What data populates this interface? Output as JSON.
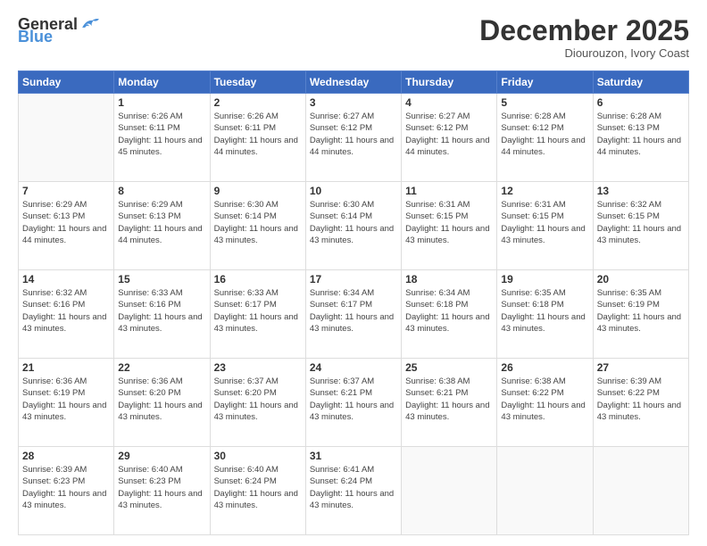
{
  "header": {
    "logo_general": "General",
    "logo_blue": "Blue",
    "month": "December 2025",
    "location": "Diourouzon, Ivory Coast"
  },
  "calendar": {
    "days_of_week": [
      "Sunday",
      "Monday",
      "Tuesday",
      "Wednesday",
      "Thursday",
      "Friday",
      "Saturday"
    ],
    "weeks": [
      [
        {
          "day": "",
          "info": ""
        },
        {
          "day": "1",
          "info": "Sunrise: 6:26 AM\nSunset: 6:11 PM\nDaylight: 11 hours and 45 minutes."
        },
        {
          "day": "2",
          "info": "Sunrise: 6:26 AM\nSunset: 6:11 PM\nDaylight: 11 hours and 44 minutes."
        },
        {
          "day": "3",
          "info": "Sunrise: 6:27 AM\nSunset: 6:12 PM\nDaylight: 11 hours and 44 minutes."
        },
        {
          "day": "4",
          "info": "Sunrise: 6:27 AM\nSunset: 6:12 PM\nDaylight: 11 hours and 44 minutes."
        },
        {
          "day": "5",
          "info": "Sunrise: 6:28 AM\nSunset: 6:12 PM\nDaylight: 11 hours and 44 minutes."
        },
        {
          "day": "6",
          "info": "Sunrise: 6:28 AM\nSunset: 6:13 PM\nDaylight: 11 hours and 44 minutes."
        }
      ],
      [
        {
          "day": "7",
          "info": "Sunrise: 6:29 AM\nSunset: 6:13 PM\nDaylight: 11 hours and 44 minutes."
        },
        {
          "day": "8",
          "info": "Sunrise: 6:29 AM\nSunset: 6:13 PM\nDaylight: 11 hours and 44 minutes."
        },
        {
          "day": "9",
          "info": "Sunrise: 6:30 AM\nSunset: 6:14 PM\nDaylight: 11 hours and 43 minutes."
        },
        {
          "day": "10",
          "info": "Sunrise: 6:30 AM\nSunset: 6:14 PM\nDaylight: 11 hours and 43 minutes."
        },
        {
          "day": "11",
          "info": "Sunrise: 6:31 AM\nSunset: 6:15 PM\nDaylight: 11 hours and 43 minutes."
        },
        {
          "day": "12",
          "info": "Sunrise: 6:31 AM\nSunset: 6:15 PM\nDaylight: 11 hours and 43 minutes."
        },
        {
          "day": "13",
          "info": "Sunrise: 6:32 AM\nSunset: 6:15 PM\nDaylight: 11 hours and 43 minutes."
        }
      ],
      [
        {
          "day": "14",
          "info": "Sunrise: 6:32 AM\nSunset: 6:16 PM\nDaylight: 11 hours and 43 minutes."
        },
        {
          "day": "15",
          "info": "Sunrise: 6:33 AM\nSunset: 6:16 PM\nDaylight: 11 hours and 43 minutes."
        },
        {
          "day": "16",
          "info": "Sunrise: 6:33 AM\nSunset: 6:17 PM\nDaylight: 11 hours and 43 minutes."
        },
        {
          "day": "17",
          "info": "Sunrise: 6:34 AM\nSunset: 6:17 PM\nDaylight: 11 hours and 43 minutes."
        },
        {
          "day": "18",
          "info": "Sunrise: 6:34 AM\nSunset: 6:18 PM\nDaylight: 11 hours and 43 minutes."
        },
        {
          "day": "19",
          "info": "Sunrise: 6:35 AM\nSunset: 6:18 PM\nDaylight: 11 hours and 43 minutes."
        },
        {
          "day": "20",
          "info": "Sunrise: 6:35 AM\nSunset: 6:19 PM\nDaylight: 11 hours and 43 minutes."
        }
      ],
      [
        {
          "day": "21",
          "info": "Sunrise: 6:36 AM\nSunset: 6:19 PM\nDaylight: 11 hours and 43 minutes."
        },
        {
          "day": "22",
          "info": "Sunrise: 6:36 AM\nSunset: 6:20 PM\nDaylight: 11 hours and 43 minutes."
        },
        {
          "day": "23",
          "info": "Sunrise: 6:37 AM\nSunset: 6:20 PM\nDaylight: 11 hours and 43 minutes."
        },
        {
          "day": "24",
          "info": "Sunrise: 6:37 AM\nSunset: 6:21 PM\nDaylight: 11 hours and 43 minutes."
        },
        {
          "day": "25",
          "info": "Sunrise: 6:38 AM\nSunset: 6:21 PM\nDaylight: 11 hours and 43 minutes."
        },
        {
          "day": "26",
          "info": "Sunrise: 6:38 AM\nSunset: 6:22 PM\nDaylight: 11 hours and 43 minutes."
        },
        {
          "day": "27",
          "info": "Sunrise: 6:39 AM\nSunset: 6:22 PM\nDaylight: 11 hours and 43 minutes."
        }
      ],
      [
        {
          "day": "28",
          "info": "Sunrise: 6:39 AM\nSunset: 6:23 PM\nDaylight: 11 hours and 43 minutes."
        },
        {
          "day": "29",
          "info": "Sunrise: 6:40 AM\nSunset: 6:23 PM\nDaylight: 11 hours and 43 minutes."
        },
        {
          "day": "30",
          "info": "Sunrise: 6:40 AM\nSunset: 6:24 PM\nDaylight: 11 hours and 43 minutes."
        },
        {
          "day": "31",
          "info": "Sunrise: 6:41 AM\nSunset: 6:24 PM\nDaylight: 11 hours and 43 minutes."
        },
        {
          "day": "",
          "info": ""
        },
        {
          "day": "",
          "info": ""
        },
        {
          "day": "",
          "info": ""
        }
      ]
    ]
  }
}
